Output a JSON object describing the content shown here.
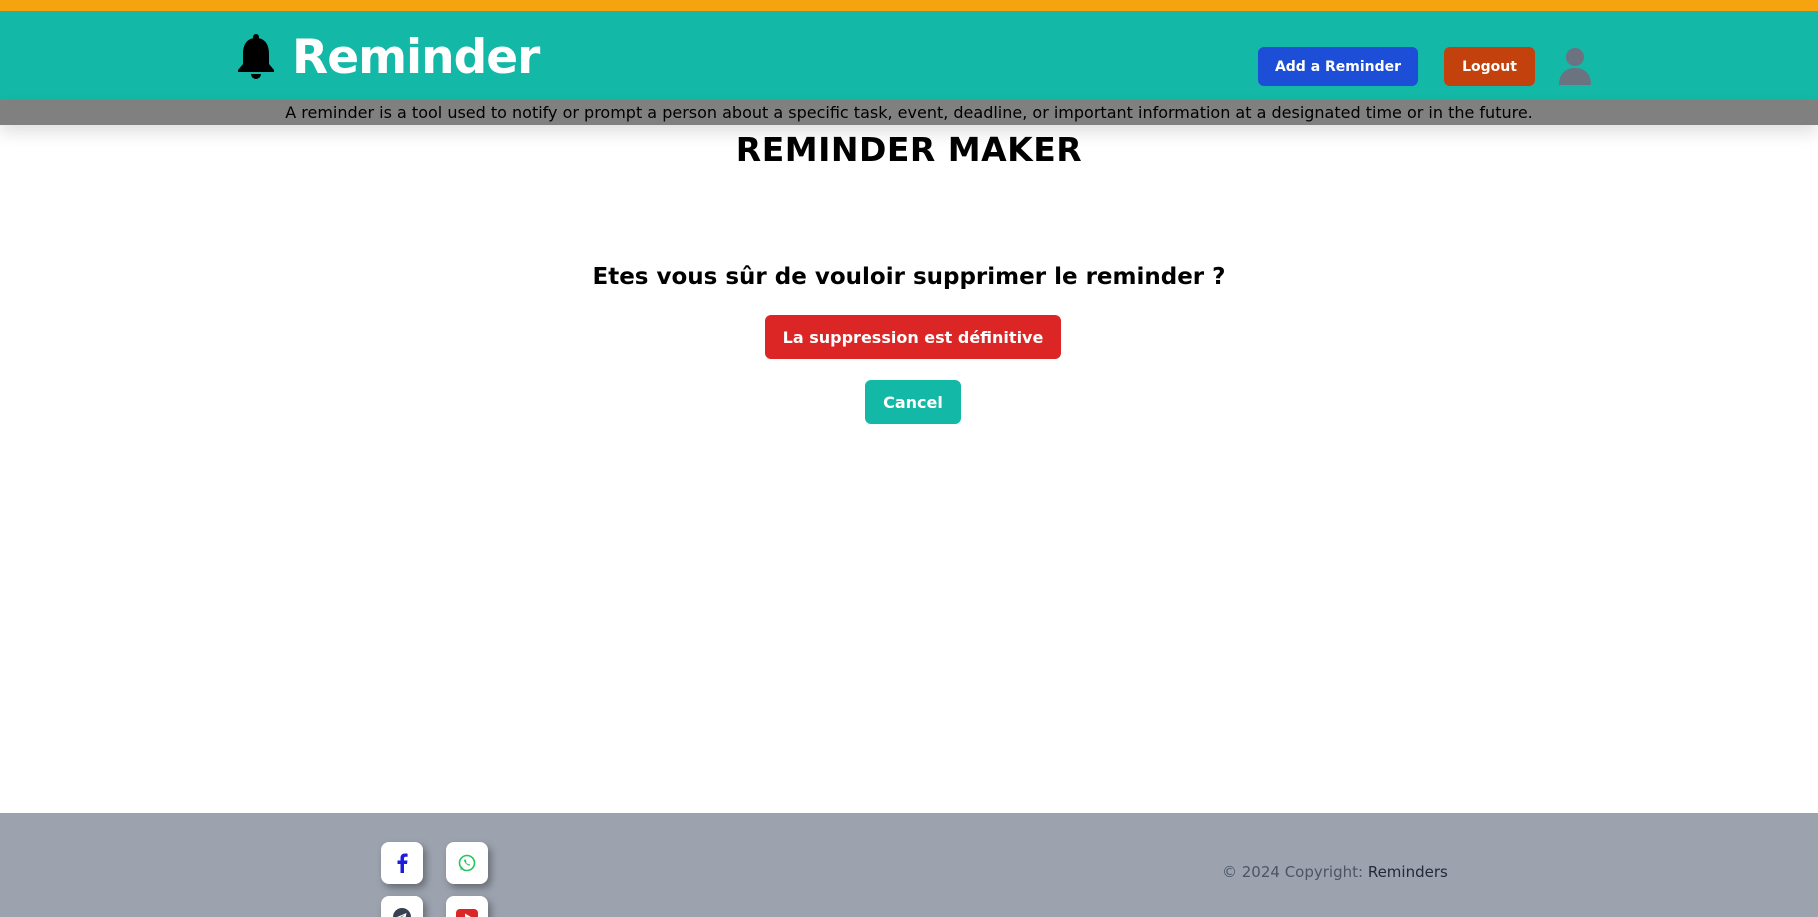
{
  "header": {
    "brand_name": "Reminder",
    "add_button": "Add a Reminder",
    "logout_button": "Logout",
    "tagline": "A reminder is a tool used to notify or prompt a person about a specific task, event, deadline, or important information at a designated time or in the future."
  },
  "main": {
    "title": "REMINDER MAKER",
    "question": "Etes vous sûr de vouloir supprimer le reminder ?",
    "delete_button": "La suppression est définitive",
    "cancel_button": "Cancel"
  },
  "footer": {
    "copyright_prefix": "© 2024 Copyright: ",
    "copyright_link": "Reminders",
    "socials": [
      "facebook-icon",
      "whatsapp-icon",
      "telegram-icon",
      "youtube-icon"
    ]
  },
  "colors": {
    "top_strip": "#f5a40f",
    "header": "#14b8a6",
    "tagline_bar": "#808080",
    "add_button": "#1d4ed8",
    "logout_button": "#c2410c",
    "delete_button": "#dc2626",
    "cancel_button": "#14b8a6",
    "footer": "#9ca3af"
  }
}
